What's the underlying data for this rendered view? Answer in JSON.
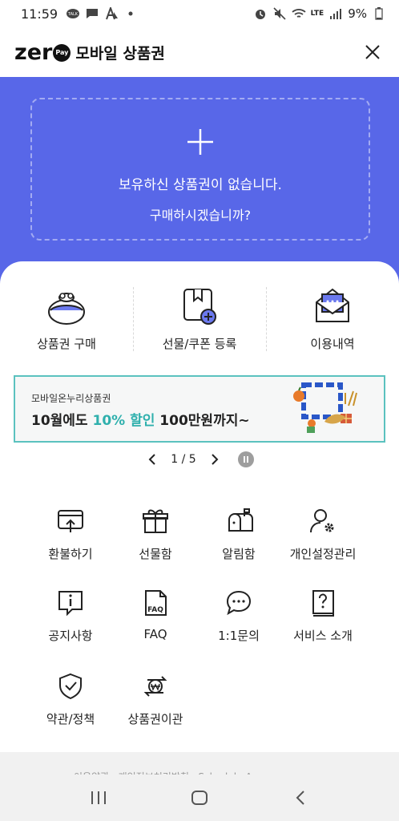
{
  "status_bar": {
    "time": "11:59",
    "battery": "9%",
    "network": "LTE"
  },
  "header": {
    "logo_text": "zer",
    "logo_badge": "Pay",
    "title": "모바일 상품권"
  },
  "hero": {
    "empty_line1": "보유하신 상품권이 없습니다.",
    "empty_line2": "구매하시겠습니까?"
  },
  "quick_actions": [
    {
      "label": "상품권 구매",
      "icon": "wallet-icon"
    },
    {
      "label": "선물/쿠폰 등록",
      "icon": "bookmark-add-icon"
    },
    {
      "label": "이용내역",
      "icon": "envelope-icon"
    }
  ],
  "banner": {
    "subtitle": "모바일온누리상품권",
    "title_prefix": "10월에도 ",
    "title_highlight": "10% 할인",
    "title_suffix": " 100만원까지~"
  },
  "pager": {
    "text": "1 / 5"
  },
  "menu": [
    {
      "label": "환불하기",
      "icon": "refund-icon"
    },
    {
      "label": "선물함",
      "icon": "gift-icon"
    },
    {
      "label": "알림함",
      "icon": "mailbox-icon"
    },
    {
      "label": "개인설정관리",
      "icon": "user-settings-icon"
    },
    {
      "label": "공지사항",
      "icon": "notice-icon"
    },
    {
      "label": "FAQ",
      "icon": "faq-icon"
    },
    {
      "label": "1:1문의",
      "icon": "chat-icon"
    },
    {
      "label": "서비스 소개",
      "icon": "help-book-icon"
    },
    {
      "label": "약관/정책",
      "icon": "shield-check-icon"
    },
    {
      "label": "상품권이관",
      "icon": "won-transfer-icon"
    }
  ],
  "footer": {
    "text": "이용약관 · 개인정보처리방침 · Schedule A"
  },
  "colors": {
    "hero_bg": "#5867e8",
    "accent_teal": "#2fb0ad",
    "banner_border": "#5bc2bf"
  }
}
